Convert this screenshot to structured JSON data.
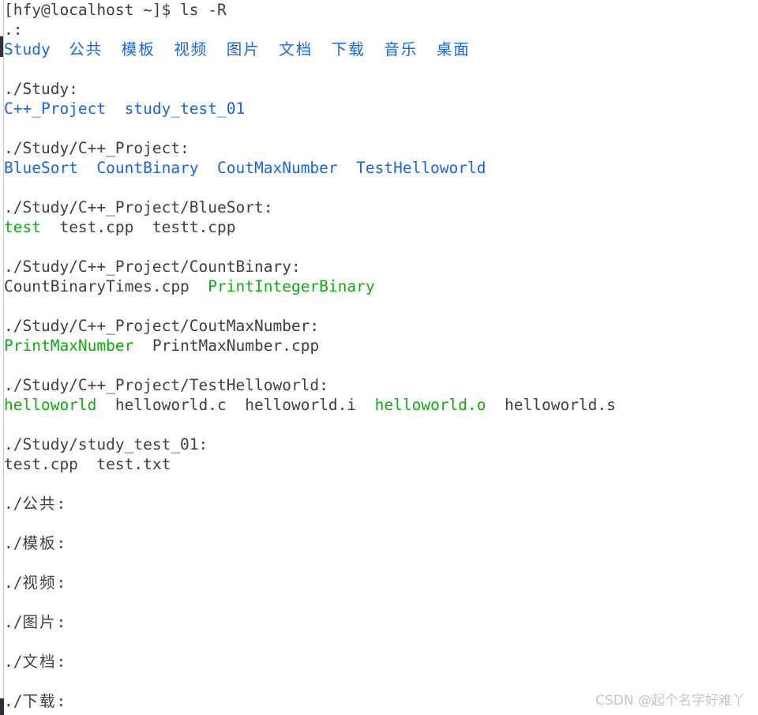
{
  "terminal": {
    "prompt_line": "[hfy@localhost ~]$ ls -R",
    "colors": {
      "background": "#ffffff",
      "default_text": "#3b4048",
      "directory": "#1766e8",
      "executable": "#0bb00b",
      "watermark": "#c6c6c6"
    },
    "command": "ls -R",
    "user": "hfy",
    "host": "localhost",
    "cwd": "~",
    "lines": [
      {
        "type": "prompt",
        "segments": [
          {
            "text": "[hfy@localhost ~]$ ls -R",
            "color": "default"
          }
        ]
      },
      {
        "type": "header",
        "segments": [
          {
            "text": ".:",
            "color": "default"
          }
        ]
      },
      {
        "type": "entries",
        "segments": [
          {
            "text": "Study",
            "color": "dir"
          },
          {
            "text": "  ",
            "color": "default"
          },
          {
            "text": "公共",
            "color": "dir",
            "cjk": true
          },
          {
            "text": "  ",
            "color": "default"
          },
          {
            "text": "模板",
            "color": "dir",
            "cjk": true
          },
          {
            "text": "  ",
            "color": "default"
          },
          {
            "text": "视频",
            "color": "dir",
            "cjk": true
          },
          {
            "text": "  ",
            "color": "default"
          },
          {
            "text": "图片",
            "color": "dir",
            "cjk": true
          },
          {
            "text": "  ",
            "color": "default"
          },
          {
            "text": "文档",
            "color": "dir",
            "cjk": true
          },
          {
            "text": "  ",
            "color": "default"
          },
          {
            "text": "下载",
            "color": "dir",
            "cjk": true
          },
          {
            "text": "  ",
            "color": "default"
          },
          {
            "text": "音乐",
            "color": "dir",
            "cjk": true
          },
          {
            "text": "  ",
            "color": "default"
          },
          {
            "text": "桌面",
            "color": "dir",
            "cjk": true
          }
        ]
      },
      {
        "type": "blank",
        "segments": []
      },
      {
        "type": "header",
        "segments": [
          {
            "text": "./Study:",
            "color": "default"
          }
        ]
      },
      {
        "type": "entries",
        "segments": [
          {
            "text": "C++_Project",
            "color": "dir"
          },
          {
            "text": "  ",
            "color": "default"
          },
          {
            "text": "study_test_01",
            "color": "dir"
          }
        ]
      },
      {
        "type": "blank",
        "segments": []
      },
      {
        "type": "header",
        "segments": [
          {
            "text": "./Study/C++_Project:",
            "color": "default"
          }
        ]
      },
      {
        "type": "entries",
        "segments": [
          {
            "text": "BlueSort",
            "color": "dir"
          },
          {
            "text": "  ",
            "color": "default"
          },
          {
            "text": "CountBinary",
            "color": "dir"
          },
          {
            "text": "  ",
            "color": "default"
          },
          {
            "text": "CoutMaxNumber",
            "color": "dir"
          },
          {
            "text": "  ",
            "color": "default"
          },
          {
            "text": "TestHelloworld",
            "color": "dir"
          }
        ]
      },
      {
        "type": "blank",
        "segments": []
      },
      {
        "type": "header",
        "segments": [
          {
            "text": "./Study/C++_Project/BlueSort:",
            "color": "default"
          }
        ]
      },
      {
        "type": "entries",
        "segments": [
          {
            "text": "test",
            "color": "exec"
          },
          {
            "text": "  ",
            "color": "default"
          },
          {
            "text": "test.cpp",
            "color": "default"
          },
          {
            "text": "  ",
            "color": "default"
          },
          {
            "text": "testt.cpp",
            "color": "default"
          }
        ]
      },
      {
        "type": "blank",
        "segments": []
      },
      {
        "type": "header",
        "segments": [
          {
            "text": "./Study/C++_Project/CountBinary:",
            "color": "default"
          }
        ]
      },
      {
        "type": "entries",
        "segments": [
          {
            "text": "CountBinaryTimes.cpp",
            "color": "default"
          },
          {
            "text": "  ",
            "color": "default"
          },
          {
            "text": "PrintIntegerBinary",
            "color": "exec"
          }
        ]
      },
      {
        "type": "blank",
        "segments": []
      },
      {
        "type": "header",
        "segments": [
          {
            "text": "./Study/C++_Project/CoutMaxNumber:",
            "color": "default"
          }
        ]
      },
      {
        "type": "entries",
        "segments": [
          {
            "text": "PrintMaxNumber",
            "color": "exec"
          },
          {
            "text": "  ",
            "color": "default"
          },
          {
            "text": "PrintMaxNumber.cpp",
            "color": "default"
          }
        ]
      },
      {
        "type": "blank",
        "segments": []
      },
      {
        "type": "header",
        "segments": [
          {
            "text": "./Study/C++_Project/TestHelloworld:",
            "color": "default"
          }
        ]
      },
      {
        "type": "entries",
        "segments": [
          {
            "text": "helloworld",
            "color": "exec"
          },
          {
            "text": "  ",
            "color": "default"
          },
          {
            "text": "helloworld.c",
            "color": "default"
          },
          {
            "text": "  ",
            "color": "default"
          },
          {
            "text": "helloworld.i",
            "color": "default"
          },
          {
            "text": "  ",
            "color": "default"
          },
          {
            "text": "helloworld.o",
            "color": "exec"
          },
          {
            "text": "  ",
            "color": "default"
          },
          {
            "text": "helloworld.s",
            "color": "default"
          }
        ]
      },
      {
        "type": "blank",
        "segments": []
      },
      {
        "type": "header",
        "segments": [
          {
            "text": "./Study/study_test_01:",
            "color": "default"
          }
        ]
      },
      {
        "type": "entries",
        "segments": [
          {
            "text": "test.cpp",
            "color": "default"
          },
          {
            "text": "  ",
            "color": "default"
          },
          {
            "text": "test.txt",
            "color": "default"
          }
        ]
      },
      {
        "type": "blank",
        "segments": []
      },
      {
        "type": "header",
        "segments": [
          {
            "text": "./",
            "color": "default"
          },
          {
            "text": "公共",
            "color": "default",
            "cjk": true
          },
          {
            "text": ":",
            "color": "default"
          }
        ]
      },
      {
        "type": "blank",
        "segments": []
      },
      {
        "type": "header",
        "segments": [
          {
            "text": "./",
            "color": "default"
          },
          {
            "text": "模板",
            "color": "default",
            "cjk": true
          },
          {
            "text": ":",
            "color": "default"
          }
        ]
      },
      {
        "type": "blank",
        "segments": []
      },
      {
        "type": "header",
        "segments": [
          {
            "text": "./",
            "color": "default"
          },
          {
            "text": "视频",
            "color": "default",
            "cjk": true
          },
          {
            "text": ":",
            "color": "default"
          }
        ]
      },
      {
        "type": "blank",
        "segments": []
      },
      {
        "type": "header",
        "segments": [
          {
            "text": "./",
            "color": "default"
          },
          {
            "text": "图片",
            "color": "default",
            "cjk": true
          },
          {
            "text": ":",
            "color": "default"
          }
        ]
      },
      {
        "type": "blank",
        "segments": []
      },
      {
        "type": "header",
        "segments": [
          {
            "text": "./",
            "color": "default"
          },
          {
            "text": "文档",
            "color": "default",
            "cjk": true
          },
          {
            "text": ":",
            "color": "default"
          }
        ]
      },
      {
        "type": "blank",
        "segments": []
      },
      {
        "type": "header",
        "segments": [
          {
            "text": "./",
            "color": "default"
          },
          {
            "text": "下载",
            "color": "default",
            "cjk": true
          },
          {
            "text": ":",
            "color": "default"
          }
        ]
      }
    ]
  },
  "watermark": {
    "text": "CSDN @起个名字好难丫"
  }
}
